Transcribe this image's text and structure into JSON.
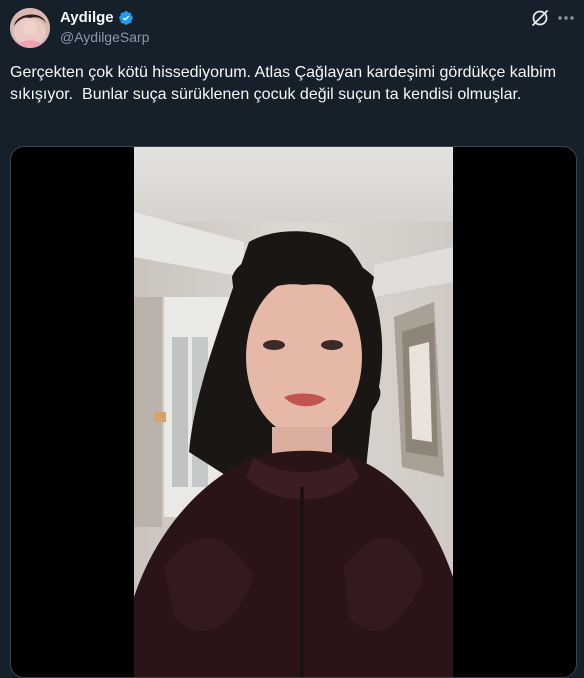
{
  "tweet": {
    "author": {
      "display_name": "Aydilge",
      "handle": "@AydilgeSarp",
      "verified_color": "#1d9bf0",
      "avatar_icon": "avatar-photo"
    },
    "actions": {
      "grok_icon": "grok-icon",
      "more_icon": "more-icon"
    },
    "text": "Gerçekten çok kötü hissediyorum. Atlas Çağlayan kardeşimi gördükçe kalbim sıkışıyor.  Bunlar suça sürüklenen çocuk değil suçun ta kendisi olmuşlar.",
    "media": {
      "type": "video",
      "description_icon": "video-frame"
    }
  },
  "colors": {
    "background": "#15202b",
    "text_primary": "#f7f9f9",
    "text_secondary": "#8b98a5",
    "border": "#38444d",
    "accent": "#1d9bf0"
  }
}
